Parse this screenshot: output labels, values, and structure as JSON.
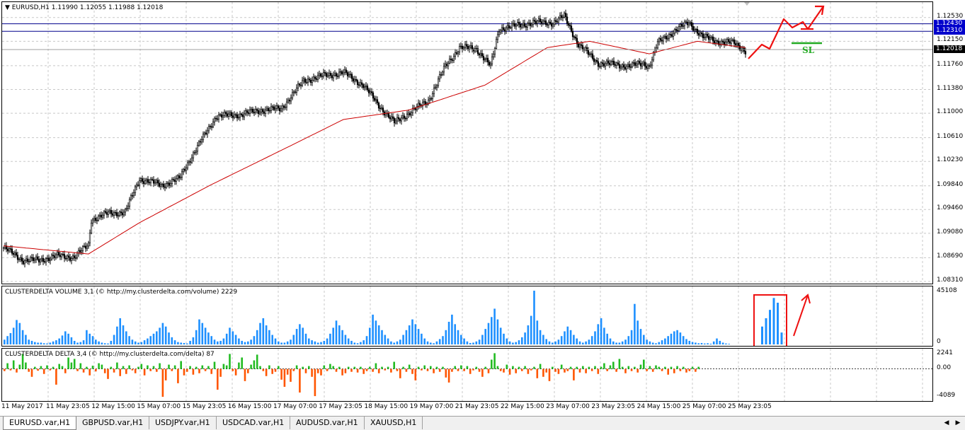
{
  "chart_data": [
    {
      "type": "candlestick",
      "title": "EURUSD,H1",
      "ohlc_readout": [
        "1.11990",
        "1.12055",
        "1.11988",
        "1.12018"
      ],
      "ylim": [
        1.0831,
        1.1272
      ],
      "y_ticks": [
        "1.12530",
        "1.12150",
        "1.11760",
        "1.11380",
        "1.11000",
        "1.10610",
        "1.10230",
        "1.09840",
        "1.09460",
        "1.09080",
        "1.08690",
        "1.08310"
      ],
      "price_tags": [
        {
          "value": "1.12430",
          "color": "#0000cc",
          "text_color": "#ffffff"
        },
        {
          "value": "1.12310",
          "color": "#0000cc",
          "text_color": "#ffffff"
        },
        {
          "value": "1.12018",
          "color": "#000000",
          "text_color": "#ffffff"
        }
      ],
      "horizontal_lines": [
        1.1243,
        1.1231
      ],
      "current_price": 1.12018,
      "close_path": [
        [
          0,
          1.0885
        ],
        [
          14,
          1.0865
        ],
        [
          25,
          1.0865
        ],
        [
          38,
          1.0872
        ],
        [
          50,
          1.087
        ],
        [
          60,
          1.089
        ],
        [
          62,
          1.093
        ],
        [
          74,
          1.094
        ],
        [
          86,
          1.0942
        ],
        [
          96,
          1.0995
        ],
        [
          112,
          1.0985
        ],
        [
          124,
          1.0995
        ],
        [
          130,
          1.102
        ],
        [
          150,
          1.1095
        ],
        [
          168,
          1.1098
        ],
        [
          182,
          1.1105
        ],
        [
          196,
          1.1107
        ],
        [
          212,
          1.1152
        ],
        [
          226,
          1.116
        ],
        [
          240,
          1.1165
        ],
        [
          254,
          1.1145
        ],
        [
          266,
          1.111
        ],
        [
          276,
          1.1085
        ],
        [
          288,
          1.1103
        ],
        [
          300,
          1.112
        ],
        [
          312,
          1.1175
        ],
        [
          322,
          1.1205
        ],
        [
          334,
          1.1203
        ],
        [
          344,
          1.1175
        ],
        [
          350,
          1.1235
        ],
        [
          362,
          1.124
        ],
        [
          374,
          1.1245
        ],
        [
          388,
          1.1245
        ],
        [
          396,
          1.1255
        ],
        [
          406,
          1.121
        ],
        [
          420,
          1.118
        ],
        [
          432,
          1.1178
        ],
        [
          442,
          1.1175
        ],
        [
          452,
          1.118
        ],
        [
          456,
          1.1175
        ],
        [
          462,
          1.1212
        ],
        [
          474,
          1.1232
        ],
        [
          484,
          1.1245
        ],
        [
          494,
          1.1222
        ],
        [
          504,
          1.1215
        ],
        [
          516,
          1.1212
        ],
        [
          524,
          1.12
        ]
      ],
      "ma_path": [
        [
          0,
          1.0888
        ],
        [
          60,
          1.0875
        ],
        [
          96,
          1.0925
        ],
        [
          146,
          1.0985
        ],
        [
          200,
          1.1045
        ],
        [
          240,
          1.109
        ],
        [
          286,
          1.1105
        ],
        [
          340,
          1.1145
        ],
        [
          384,
          1.1205
        ],
        [
          414,
          1.1215
        ],
        [
          456,
          1.1195
        ],
        [
          490,
          1.1215
        ],
        [
          524,
          1.1205
        ]
      ],
      "annotation": "SL",
      "sl_level": 1.1212
    },
    {
      "type": "bar",
      "title": "CLUSTERDELTA VOLUME 3,1 (© http://my.clusterdelta.com/volume) 2229",
      "y_ticks": [
        "45108",
        "0"
      ],
      "ylim": [
        0,
        45108
      ],
      "color": "#1e90ff",
      "values": [
        4000,
        7000,
        9500,
        14000,
        20500,
        18000,
        12000,
        8000,
        4000,
        3000,
        2000,
        1500,
        1500,
        1000,
        800,
        1500,
        2500,
        3500,
        5000,
        7500,
        11000,
        9000,
        6000,
        3000,
        1500,
        2000,
        3500,
        12000,
        9000,
        7000,
        4000,
        2500,
        1500,
        1000,
        800,
        3000,
        8000,
        15000,
        22000,
        16000,
        11000,
        7000,
        4000,
        2500,
        1500,
        2000,
        3500,
        5000,
        7000,
        9000,
        11000,
        14000,
        18000,
        15000,
        10000,
        6000,
        3500,
        2000,
        1500,
        1200,
        800,
        3000,
        6000,
        12000,
        21000,
        18000,
        14000,
        10000,
        7000,
        4000,
        2500,
        3000,
        5000,
        9000,
        14000,
        11000,
        8000,
        5000,
        3000,
        2000,
        2500,
        4000,
        7000,
        12000,
        18000,
        22000,
        16000,
        12000,
        8000,
        5000,
        2500,
        1500,
        1500,
        2500,
        4000,
        8000,
        13000,
        17000,
        14000,
        9000,
        5000,
        3500,
        2500,
        1500,
        2000,
        3000,
        5000,
        9000,
        14000,
        20000,
        16000,
        12000,
        8000,
        5000,
        3000,
        1500,
        1000,
        2000,
        3500,
        7000,
        14000,
        25000,
        20000,
        16000,
        12000,
        8000,
        5000,
        2500,
        1500,
        2500,
        4000,
        8000,
        12000,
        16000,
        21000,
        17000,
        13000,
        9000,
        5000,
        2500,
        1500,
        1000,
        2500,
        4500,
        7000,
        12000,
        19000,
        25000,
        17000,
        12000,
        8000,
        5000,
        2500,
        1200,
        1500,
        2500,
        4000,
        8000,
        13000,
        18000,
        23000,
        30000,
        21000,
        14000,
        9000,
        5000,
        2500,
        1500,
        2000,
        3500,
        6000,
        10000,
        16000,
        24000,
        45108,
        20000,
        12000,
        8000,
        4500,
        2500,
        1500,
        2500,
        4000,
        7000,
        11000,
        15000,
        12000,
        8000,
        5000,
        2500,
        1500,
        2500,
        4000,
        7000,
        11000,
        17000,
        22000,
        14000,
        9000,
        5000,
        2500,
        1500,
        1500,
        2500,
        4000,
        7000,
        12000,
        34000,
        20000,
        13000,
        8000,
        4000,
        2500,
        1500,
        1000,
        2000,
        3500,
        5000,
        7000,
        9000,
        11000,
        12000,
        10000,
        7000,
        4500,
        3000,
        2000,
        1500,
        1000,
        1200,
        800,
        1000,
        600,
        2500,
        5000,
        3000,
        1500,
        800,
        500
      ],
      "highlight_values": [
        15000,
        22000,
        29000,
        39000,
        35000,
        10000
      ]
    },
    {
      "type": "bar",
      "title": "CLUSTERDELTA DELTA 3,4 (© http://my.clusterdelta.com/delta) 87",
      "y_ticks": [
        "2241",
        "0.00",
        "-4089"
      ],
      "ylim": [
        -4089,
        2241
      ],
      "colors": {
        "positive": "#22bb22",
        "negative": "#ff5500"
      },
      "values": [
        -300,
        800,
        -200,
        1200,
        -500,
        600,
        2100,
        900,
        -400,
        -1100,
        300,
        -250,
        400,
        -700,
        500,
        -200,
        300,
        -2200,
        700,
        400,
        -600,
        1600,
        900,
        1400,
        -300,
        800,
        -500,
        300,
        -900,
        450,
        -350,
        800,
        600,
        -600,
        -1400,
        300,
        -500,
        900,
        -1000,
        400,
        -700,
        500,
        -200,
        -600,
        300,
        700,
        -900,
        500,
        -300,
        400,
        -400,
        800,
        -3900,
        -1600,
        600,
        -300,
        500,
        -2000,
        1100,
        -900,
        -400,
        400,
        -800,
        300,
        -600,
        500,
        -300,
        400,
        -700,
        1000,
        -2900,
        -1100,
        700,
        500,
        2100,
        -300,
        -900,
        900,
        1600,
        -1700,
        -600,
        600,
        1200,
        2000,
        400,
        -300,
        -1000,
        500,
        -700,
        -400,
        400,
        -1500,
        -2500,
        -800,
        -1800,
        -300,
        500,
        -3300,
        300,
        -600,
        400,
        -1100,
        -3800,
        -600,
        -900,
        500,
        -300,
        700,
        400,
        -400,
        300,
        -900,
        -600,
        300,
        -400,
        300,
        -500,
        300,
        -700,
        -300,
        300,
        -400,
        800,
        -600,
        300,
        -200,
        300,
        -500,
        1000,
        -300,
        -1300,
        300,
        -400,
        600,
        -700,
        -1600,
        300,
        -200,
        500,
        -300,
        400,
        -600,
        300,
        -400,
        300,
        -1200,
        -1900,
        -400,
        400,
        -300,
        500,
        -300,
        400,
        -700,
        -200,
        300,
        -400,
        -1100,
        300,
        -600,
        1300,
        2200,
        400,
        -300,
        -500,
        600,
        -800,
        400,
        -600,
        300,
        -300,
        400,
        -700,
        -200,
        300,
        -1300,
        700,
        -1100,
        -500,
        -1700,
        300,
        -400,
        -700,
        600,
        -500,
        -300,
        300,
        -1600,
        300,
        -500,
        400,
        -600,
        300,
        -300,
        400,
        -700,
        300,
        800,
        -300,
        500,
        1000,
        -400,
        1400,
        300,
        -600,
        400,
        -300,
        300,
        -500,
        600,
        1300,
        -300,
        400,
        -400,
        500,
        300,
        -300,
        300,
        -800,
        300,
        -600,
        400,
        -300,
        300,
        -500,
        -300,
        300,
        -400,
        300
      ]
    }
  ],
  "time_axis": {
    "labels": [
      "11 May 2017",
      "11 May 23:05",
      "12 May 15:00",
      "15 May 07:00",
      "15 May 23:05",
      "16 May 15:00",
      "17 May 07:00",
      "17 May 23:05",
      "18 May 15:00",
      "19 May 07:00",
      "21 May 23:05",
      "22 May 15:00",
      "23 May 07:00",
      "23 May 23:05",
      "24 May 15:00",
      "25 May 07:00",
      "25 May 23:05"
    ]
  },
  "tabs": [
    {
      "label": "EURUSD.var,H1",
      "active": true
    },
    {
      "label": "GBPUSD.var,H1",
      "active": false
    },
    {
      "label": "USDJPY.var,H1",
      "active": false
    },
    {
      "label": "USDCAD.var,H1",
      "active": false
    },
    {
      "label": "AUDUSD.var,H1",
      "active": false
    },
    {
      "label": "XAUUSD,H1",
      "active": false
    }
  ],
  "colors": {
    "bull_candle": "#ffffff",
    "bear_candle": "#000000",
    "moving_average": "#cc0000",
    "hline": "#00008b",
    "grid": "#c8c8c8",
    "annotation_red": "#ee1111",
    "sl_green": "#22aa22"
  }
}
